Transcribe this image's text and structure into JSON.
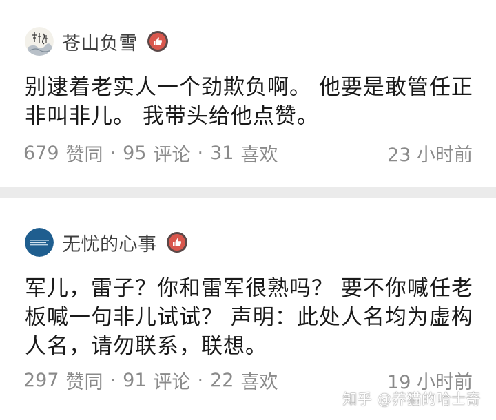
{
  "comments": [
    {
      "author": "苍山负雪",
      "avatar_icon": "calligraphy-ink-avatar",
      "badge_icon": "thumbs-up-icon",
      "text_lines": [
        "别逮着老实人一个劲欺负啊。 他要是敢管任正",
        "非叫非儿。 我带头给他点赞。"
      ],
      "likes": "679",
      "likes_label": "赞同",
      "replies": "95",
      "replies_label": "评论",
      "favorites": "31",
      "favorites_label": "喜欢",
      "time": "23 小时前"
    },
    {
      "author": "无忧的心事",
      "avatar_icon": "blue-circle-text-avatar",
      "badge_icon": "thumbs-up-icon",
      "text_lines": [
        "军儿，雷子？你和雷军很熟吗？ 要不你喊任老",
        "板喊一句非儿试试？ 声明：此处人名均为虚构",
        "人名，请勿联系，联想。"
      ],
      "likes": "297",
      "likes_label": "赞同",
      "replies": "91",
      "replies_label": "评论",
      "favorites": "22",
      "favorites_label": "喜欢",
      "time": "19 小时前"
    }
  ],
  "separator": "·",
  "watermark": "知乎 @养猫的哈士奇",
  "colors": {
    "page_bg": "#ebebeb",
    "card_bg": "#ffffff",
    "text": "#1a1a1a",
    "meta": "#8a8a8a",
    "badge_red": "#d9574d",
    "avatar_blue": "#1f5e8f"
  }
}
